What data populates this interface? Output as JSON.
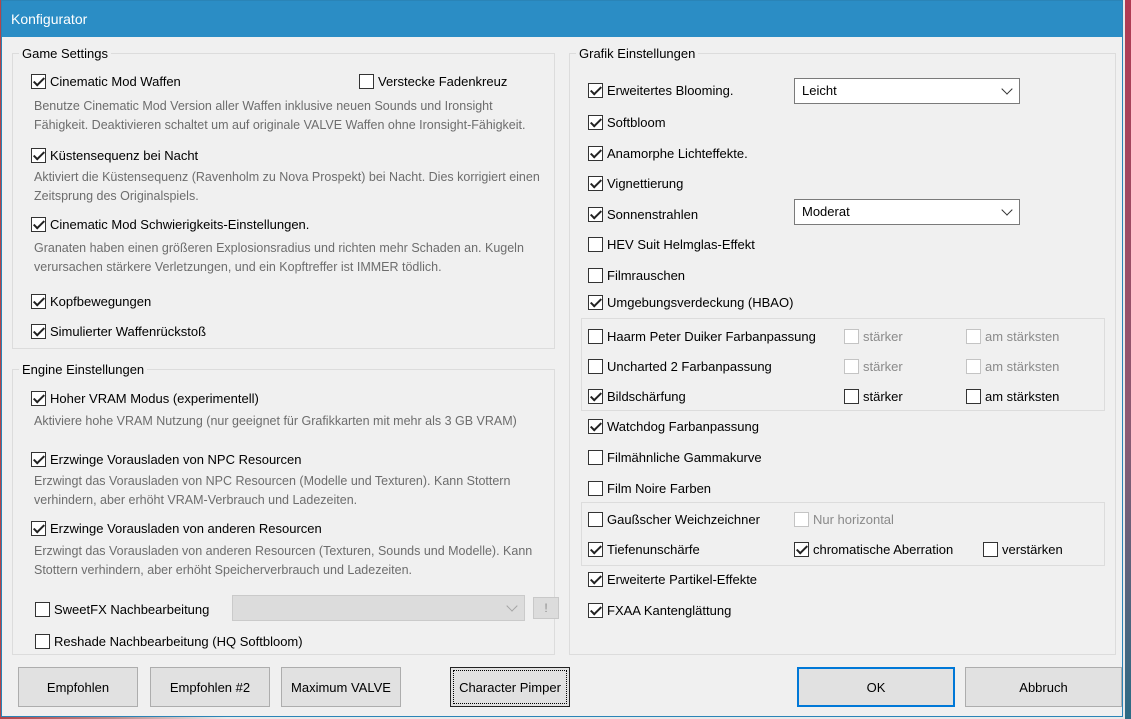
{
  "window": {
    "title": "Konfigurator"
  },
  "game_settings": {
    "title": "Game Settings",
    "cinematic_weapons": {
      "label": "Cinematic Mod Waffen",
      "checked": true
    },
    "hide_crosshair": {
      "label": "Verstecke Fadenkreuz",
      "checked": false
    },
    "cinematic_weapons_desc": "Benutze Cinematic Mod Version aller Waffen inklusive neuen Sounds und Ironsight Fähigkeit. Deaktivieren schaltet um auf originale VALVE Waffen ohne Ironsight-Fähigkeit.",
    "coast_night": {
      "label": "Küstensequenz bei Nacht",
      "checked": true
    },
    "coast_night_desc": "Aktiviert die Küstensequenz (Ravenholm zu Nova Prospekt) bei Nacht. Dies korrigiert einen Zeitsprung des Originalspiels.",
    "difficulty": {
      "label": "Cinematic Mod Schwierigkeits-Einstellungen.",
      "checked": true
    },
    "difficulty_desc": "Granaten haben einen größeren Explosionsradius und richten mehr Schaden an. Kugeln verursachen stärkere Verletzungen, und ein Kopftreffer ist IMMER tödlich.",
    "head_bob": {
      "label": "Kopfbewegungen",
      "checked": true
    },
    "recoil": {
      "label": "Simulierter Waffenrückstoß",
      "checked": true
    }
  },
  "engine_settings": {
    "title": "Engine Einstellungen",
    "high_vram": {
      "label": "Hoher VRAM Modus (experimentell)",
      "checked": true
    },
    "high_vram_desc": "Aktiviere hohe VRAM Nutzung (nur geeignet für Grafikkarten mit mehr als 3 GB VRAM)",
    "preload_npc": {
      "label": "Erzwinge Vorausladen von NPC Resourcen",
      "checked": true
    },
    "preload_npc_desc": "Erzwingt das Vorausladen von NPC Resourcen (Modelle und Texturen). Kann Stottern verhindern, aber erhöht VRAM-Verbrauch und Ladezeiten.",
    "preload_other": {
      "label": "Erzwinge Vorausladen von anderen Resourcen",
      "checked": true
    },
    "preload_other_desc": "Erzwingt das Vorausladen von anderen Resourcen (Texturen, Sounds und Modelle). Kann Stottern verhindern, aber erhöht Speicherverbrauch und Ladezeiten.",
    "sweetfx": {
      "label": "SweetFX Nachbearbeitung",
      "checked": false,
      "select_value": ""
    },
    "sweetfx_button": "!",
    "reshade": {
      "label": "Reshade Nachbearbeitung (HQ Softbloom)",
      "checked": false
    }
  },
  "graphics": {
    "title": "Grafik Einstellungen",
    "blooming": {
      "label": "Erweitertes Blooming.",
      "checked": true,
      "select_value": "Leicht"
    },
    "softbloom": {
      "label": "Softbloom",
      "checked": true
    },
    "anamorphic": {
      "label": "Anamorphe Lichteffekte.",
      "checked": true
    },
    "vignette": {
      "label": "Vignettierung",
      "checked": true
    },
    "sunrays": {
      "label": "Sonnenstrahlen",
      "checked": true,
      "select_value": "Moderat"
    },
    "hev_helmet": {
      "label": "HEV Suit Helmglas-Effekt",
      "checked": false
    },
    "film_grain": {
      "label": "Filmrauschen",
      "checked": false
    },
    "hbao": {
      "label": "Umgebungsverdeckung (HBAO)",
      "checked": true
    },
    "haarm": {
      "label": "Haarm Peter Duiker Farbanpassung",
      "checked": false
    },
    "uncharted": {
      "label": "Uncharted 2 Farbanpassung",
      "checked": false
    },
    "sharpen": {
      "label": "Bildschärfung",
      "checked": true
    },
    "stronger": "stärker",
    "strongest": "am stärksten",
    "watchdog": {
      "label": "Watchdog Farbanpassung",
      "checked": true
    },
    "film_gamma": {
      "label": "Filmähnliche Gammakurve",
      "checked": false
    },
    "film_noir": {
      "label": "Film Noire Farben",
      "checked": false
    },
    "gauss": {
      "label": "Gaußscher Weichzeichner",
      "checked": false
    },
    "horizontal_only": "Nur horizontal",
    "dof": {
      "label": "Tiefenunschärfe",
      "checked": true
    },
    "chromatic": {
      "label": "chromatische Aberration",
      "checked": true
    },
    "amplify": {
      "label": "verstärken",
      "checked": false
    },
    "particles": {
      "label": "Erweiterte Partikel-Effekte",
      "checked": true
    },
    "fxaa": {
      "label": "FXAA Kantenglättung",
      "checked": true
    }
  },
  "buttons": {
    "recommended": "Empfohlen",
    "recommended2": "Empfohlen #2",
    "max_valve": "Maximum VALVE",
    "character_pimper": "Character Pimper",
    "ok": "OK",
    "cancel": "Abbruch"
  }
}
